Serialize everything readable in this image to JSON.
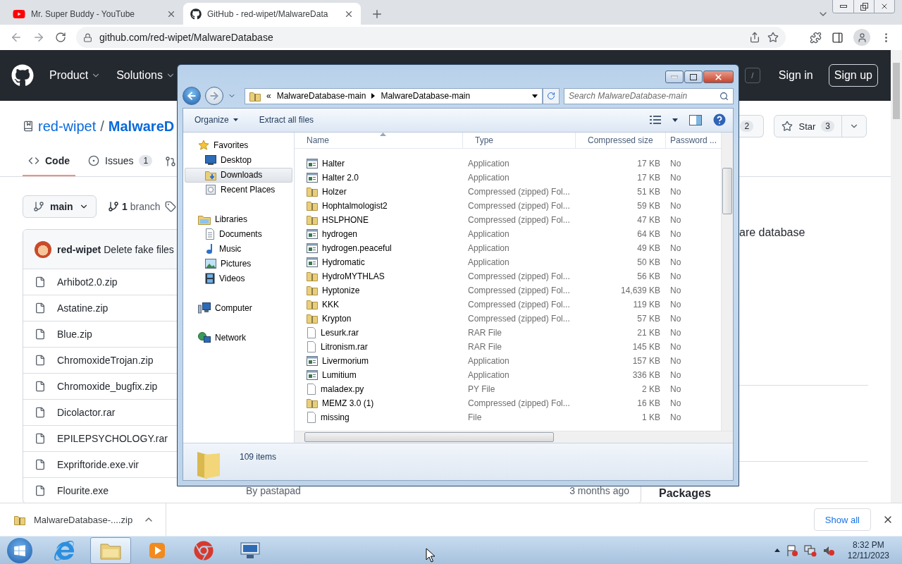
{
  "browser": {
    "tabs": [
      {
        "title": "Mr. Super Buddy - YouTube",
        "kind": "youtube",
        "selected": false
      },
      {
        "title": "GitHub - red-wipet/MalwareData",
        "kind": "github",
        "selected": true
      }
    ],
    "url": "github.com/red-wipet/MalwareDatabase"
  },
  "github": {
    "nav": [
      "Product",
      "Solutions"
    ],
    "search_key": "/",
    "sign_in": "Sign in",
    "sign_up": "Sign up",
    "owner": "red-wipet",
    "separator": "/",
    "repo": "MalwareD",
    "watch_count": "2",
    "star": {
      "label": "Star",
      "count": "3"
    },
    "tabs": [
      {
        "label": "Code",
        "kind": "code",
        "selected": true
      },
      {
        "label": "Issues",
        "count": "1",
        "kind": "issues",
        "selected": false
      }
    ],
    "branch": "main",
    "branches": {
      "count": "1",
      "label": "branch"
    },
    "commit": {
      "author": "red-wipet",
      "message": "Delete fake files"
    },
    "files": [
      {
        "name": "Arhibot2.0.zip"
      },
      {
        "name": "Astatine.zip"
      },
      {
        "name": "Blue.zip"
      },
      {
        "name": "ChromoxideTrojan.zip"
      },
      {
        "name": "Chromoxide_bugfix.zip"
      },
      {
        "name": "Dicolactor.rar"
      },
      {
        "name": "EPILEPSYCHOLOGY.rar"
      },
      {
        "name": "Expriftoride.exe.vir"
      },
      {
        "name": "Flourite.exe",
        "message": "By pastapad",
        "date": "3 months ago"
      }
    ],
    "about": "are database",
    "sidebar_heading": "Packages"
  },
  "explorer": {
    "breadcrumb": {
      "overflow": "«",
      "segments": [
        "MalwareDatabase-main",
        "MalwareDatabase-main"
      ]
    },
    "search_placeholder": "Search MalwareDatabase-main",
    "commands": [
      {
        "label": "Organize",
        "menu": true
      },
      {
        "label": "Extract all files",
        "menu": false
      }
    ],
    "nav": [
      {
        "label": "Favorites",
        "kind": "favorites",
        "selected": false,
        "children": [
          {
            "label": "Desktop",
            "kind": "desktop",
            "selected": false
          },
          {
            "label": "Downloads",
            "kind": "downloads",
            "selected": true
          },
          {
            "label": "Recent Places",
            "kind": "recent",
            "selected": false
          }
        ]
      },
      {
        "label": "Libraries",
        "kind": "libraries",
        "selected": false,
        "children": [
          {
            "label": "Documents",
            "kind": "documents",
            "selected": false
          },
          {
            "label": "Music",
            "kind": "music",
            "selected": false
          },
          {
            "label": "Pictures",
            "kind": "pictures",
            "selected": false
          },
          {
            "label": "Videos",
            "kind": "videos",
            "selected": false
          }
        ]
      },
      {
        "label": "Computer",
        "kind": "computer",
        "selected": false
      },
      {
        "label": "Network",
        "kind": "network",
        "selected": false
      }
    ],
    "columns": [
      "Name",
      "Type",
      "Compressed size",
      "Password ..."
    ],
    "rows": [
      {
        "name": "Halter",
        "kind": "application",
        "type": "Application",
        "size": "17 KB",
        "password": "No"
      },
      {
        "name": "Halter 2.0",
        "kind": "application",
        "type": "Application",
        "size": "17 KB",
        "password": "No"
      },
      {
        "name": "Holzer",
        "kind": "zip",
        "type": "Compressed (zipped) Fol...",
        "size": "51 KB",
        "password": "No"
      },
      {
        "name": "Hophtalmologist2",
        "kind": "zip",
        "type": "Compressed (zipped) Fol...",
        "size": "59 KB",
        "password": "No"
      },
      {
        "name": "HSLPHONE",
        "kind": "zip",
        "type": "Compressed (zipped) Fol...",
        "size": "47 KB",
        "password": "No"
      },
      {
        "name": "hydrogen",
        "kind": "application",
        "type": "Application",
        "size": "64 KB",
        "password": "No"
      },
      {
        "name": "hydrogen.peaceful",
        "kind": "application",
        "type": "Application",
        "size": "49 KB",
        "password": "No"
      },
      {
        "name": "Hydromatic",
        "kind": "application",
        "type": "Application",
        "size": "50 KB",
        "password": "No"
      },
      {
        "name": "HydroMYTHLAS",
        "kind": "zip",
        "type": "Compressed (zipped) Fol...",
        "size": "56 KB",
        "password": "No"
      },
      {
        "name": "Hyptonize",
        "kind": "zip",
        "type": "Compressed (zipped) Fol...",
        "size": "14,639 KB",
        "password": "No"
      },
      {
        "name": "KKK",
        "kind": "zip",
        "type": "Compressed (zipped) Fol...",
        "size": "119 KB",
        "password": "No"
      },
      {
        "name": "Krypton",
        "kind": "zip",
        "type": "Compressed (zipped) Fol...",
        "size": "57 KB",
        "password": "No"
      },
      {
        "name": "Lesurk.rar",
        "kind": "file",
        "type": "RAR File",
        "size": "21 KB",
        "password": "No"
      },
      {
        "name": "Litronism.rar",
        "kind": "file",
        "type": "RAR File",
        "size": "145 KB",
        "password": "No"
      },
      {
        "name": "Livermorium",
        "kind": "application",
        "type": "Application",
        "size": "157 KB",
        "password": "No"
      },
      {
        "name": "Lumitium",
        "kind": "application",
        "type": "Application",
        "size": "336 KB",
        "password": "No"
      },
      {
        "name": "maladex.py",
        "kind": "file",
        "type": "PY File",
        "size": "2 KB",
        "password": "No"
      },
      {
        "name": "MEMZ 3.0 (1)",
        "kind": "zip",
        "type": "Compressed (zipped) Fol...",
        "size": "16 KB",
        "password": "No"
      },
      {
        "name": "missing",
        "kind": "file",
        "type": "File",
        "size": "1 KB",
        "password": "No"
      }
    ],
    "status": "109 items"
  },
  "downloads": {
    "item": "MalwareDatabase-....zip",
    "show_all": "Show all"
  },
  "taskbar": {
    "items": [
      {
        "kind": "ie",
        "active": false
      },
      {
        "kind": "explorer",
        "active": true
      },
      {
        "kind": "media",
        "active": false
      },
      {
        "kind": "chrome",
        "active": false
      },
      {
        "kind": "remote",
        "active": false
      }
    ],
    "time": "8:32 PM",
    "date": "12/11/2023"
  }
}
